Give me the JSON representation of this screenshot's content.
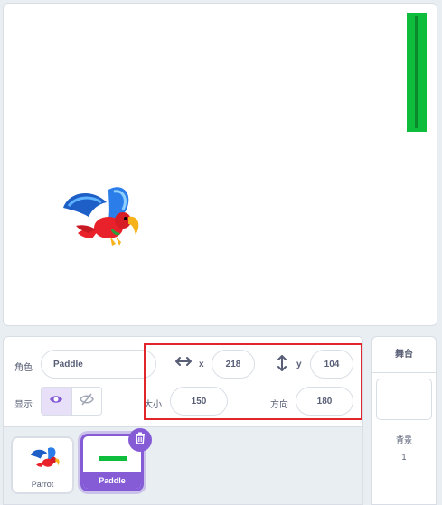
{
  "stage": {
    "sprites": [
      {
        "name": "Parrot",
        "icon": "parrot-sprite"
      },
      {
        "name": "Paddle",
        "icon": "paddle-sprite"
      }
    ]
  },
  "sprite_info": {
    "sprite_label": "角色",
    "sprite_name": "Paddle",
    "x_label": "x",
    "x_value": "218",
    "y_label": "y",
    "y_value": "104",
    "show_label": "显示",
    "size_label": "大小",
    "size_value": "150",
    "direction_label": "方向",
    "direction_value": "180",
    "highlight_color": "#e0262a"
  },
  "sprite_list": {
    "items": [
      {
        "label": "Parrot",
        "selected": false
      },
      {
        "label": "Paddle",
        "selected": true
      }
    ]
  },
  "stage_pane": {
    "title": "舞台",
    "backdrop_label": "背景",
    "backdrop_count": "1"
  },
  "colors": {
    "accent": "#855cd6",
    "paddle_green": "#0fbd3c"
  }
}
